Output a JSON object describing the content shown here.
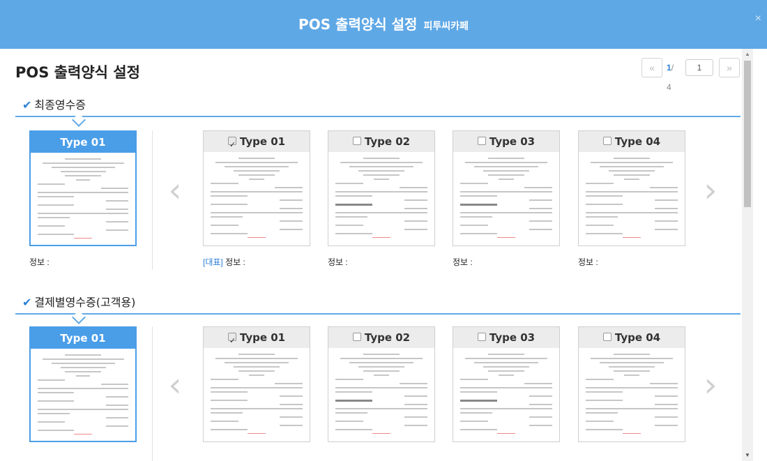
{
  "window": {
    "title": "POS 출력양식 설정",
    "subtitle": "피투씨카페",
    "close_glyph": "×"
  },
  "page": {
    "heading": "POS 출력양식 설정"
  },
  "pager": {
    "prev_glyph": "«",
    "next_glyph": "»",
    "current": "1",
    "total_text": "/ 4",
    "input_value": "1"
  },
  "sections": [
    {
      "title": "최종영수증",
      "check_glyph": "✔",
      "selected": {
        "label": "Type 01",
        "caption": "정보 :"
      },
      "options": [
        {
          "label": "Type 01",
          "checked": true,
          "tag": "[대표]",
          "caption": "정보 :"
        },
        {
          "label": "Type 02",
          "checked": false,
          "tag": "",
          "caption": "정보 :"
        },
        {
          "label": "Type 03",
          "checked": false,
          "tag": "",
          "caption": "정보 :"
        },
        {
          "label": "Type 04",
          "checked": false,
          "tag": "",
          "caption": "정보 :"
        }
      ]
    },
    {
      "title": "결제별영수증(고객용)",
      "check_glyph": "✔",
      "selected": {
        "label": "Type 01"
      },
      "options": [
        {
          "label": "Type 01",
          "checked": true
        },
        {
          "label": "Type 02",
          "checked": false
        },
        {
          "label": "Type 03",
          "checked": false
        },
        {
          "label": "Type 04",
          "checked": false
        }
      ]
    }
  ],
  "carousel": {
    "left_glyph": "‹",
    "right_glyph": "›"
  },
  "scrollbar": {
    "up_glyph": "▲",
    "down_glyph": "▼"
  },
  "colors": {
    "header_bg": "#5fa8e6",
    "selected_accent": "#4a9ee8",
    "link_blue": "#2b7fd6"
  }
}
